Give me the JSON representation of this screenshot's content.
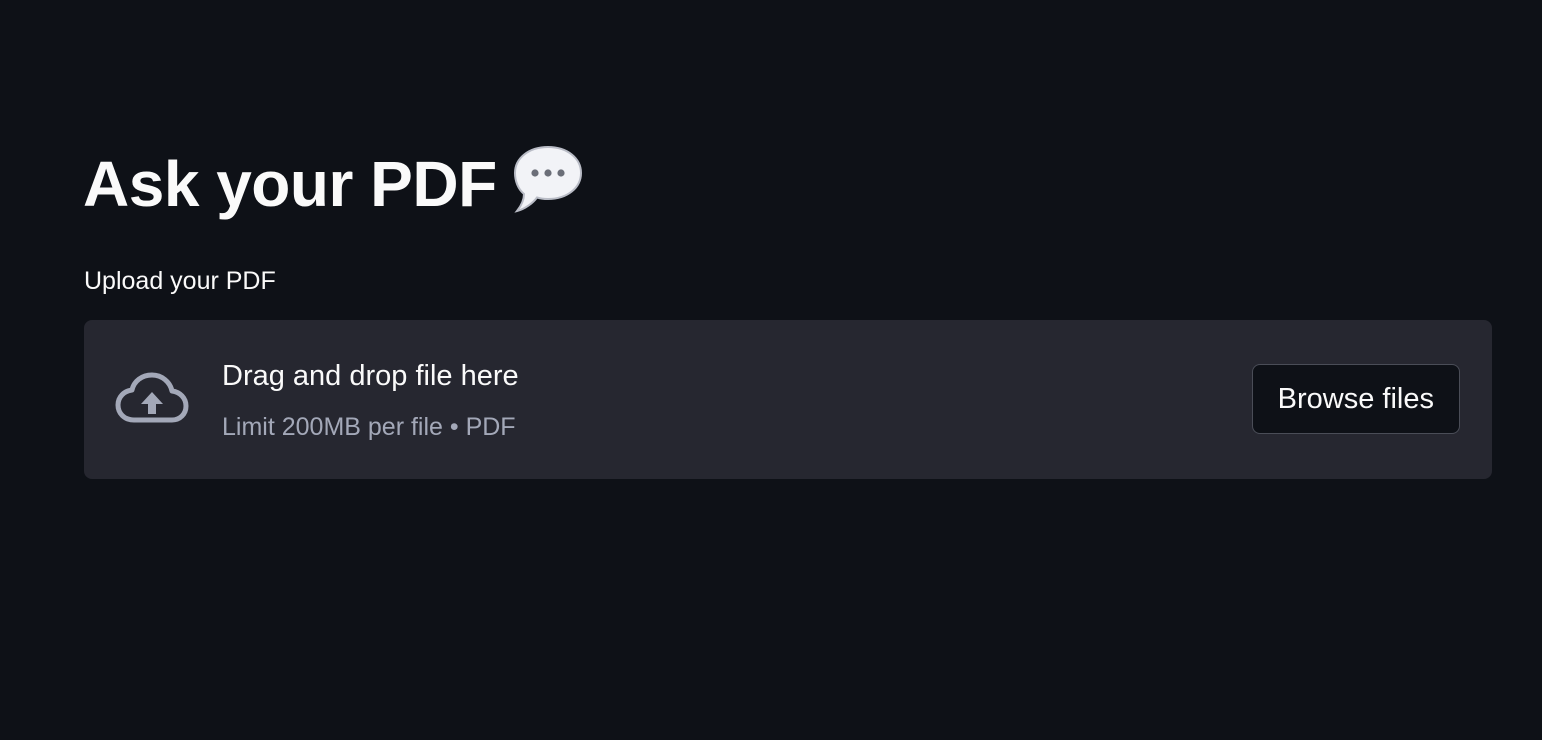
{
  "header": {
    "title": "Ask your PDF",
    "title_emoji": "speech-balloon-icon"
  },
  "uploader": {
    "label": "Upload your PDF",
    "dropzone_title": "Drag and drop file here",
    "dropzone_limit": "Limit 200MB per file • PDF",
    "browse_label": "Browse files",
    "icon": "cloud-upload-icon"
  },
  "colors": {
    "background": "#0e1117",
    "dropzone": "#262730",
    "text": "#fafafa",
    "muted_text": "#a3a8b8"
  }
}
